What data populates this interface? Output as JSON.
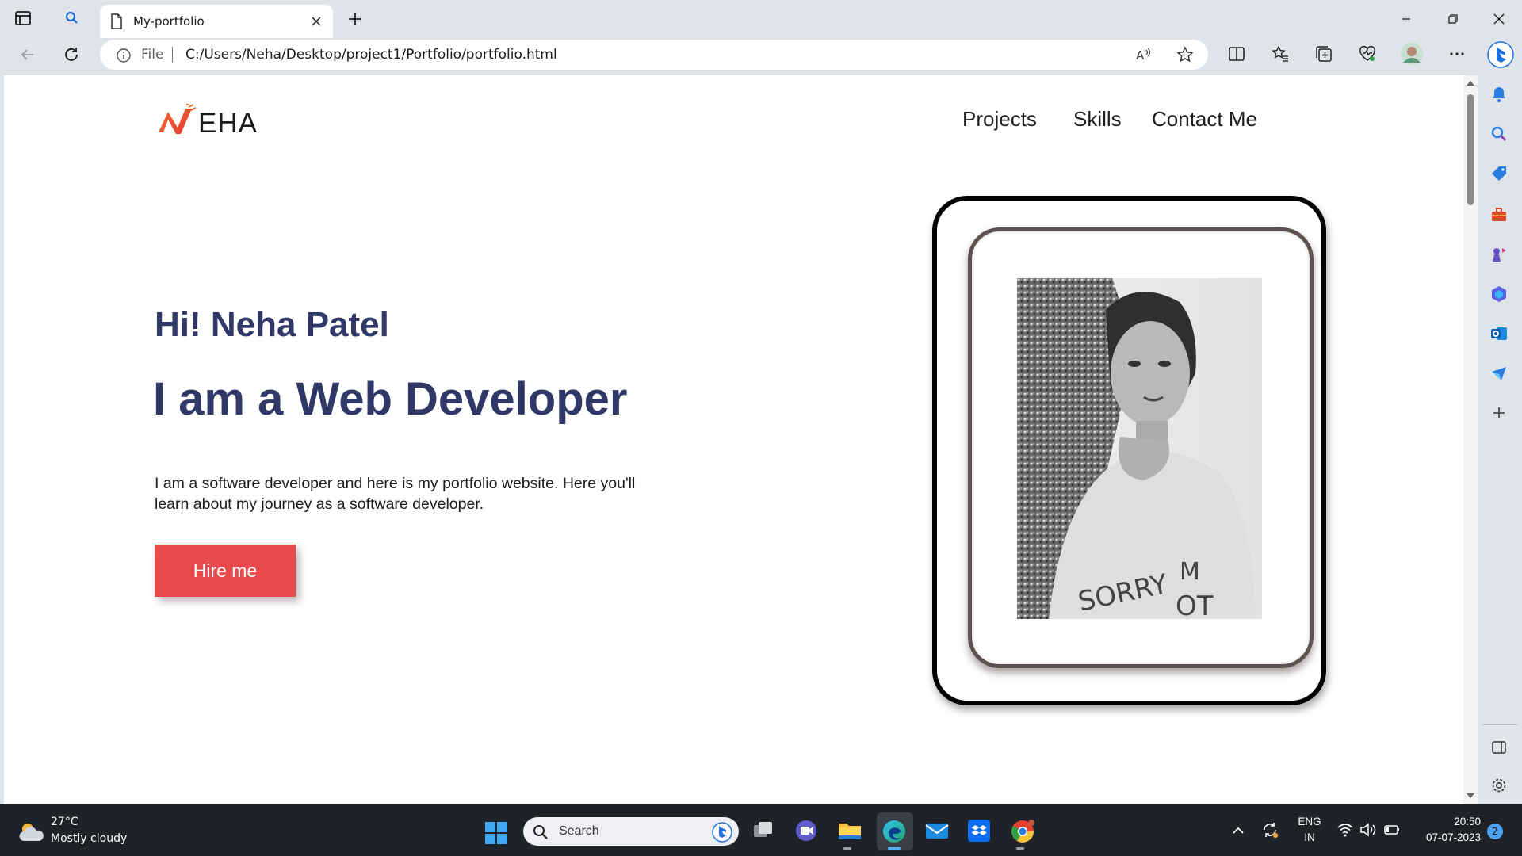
{
  "browser": {
    "tab_title": "My-portfolio",
    "address_prefix": "File",
    "url": "C:/Users/Neha/Desktop/project1/Portfolio/portfolio.html"
  },
  "page": {
    "logo_text": "EHA",
    "nav": [
      "Projects",
      "Skills",
      "Contact Me"
    ],
    "greeting": "Hi! Neha Patel",
    "headline": "I am a Web Developer",
    "intro": "I am a software developer and here is my portfolio website. Here you'll learn about my journey as a software developer.",
    "cta_label": "Hire me",
    "photo_alt": "Portrait photo",
    "accent_color": "#e84a4d",
    "heading_color": "#2f3866"
  },
  "taskbar": {
    "weather_temp": "27°C",
    "weather_desc": "Mostly cloudy",
    "search_placeholder": "Search",
    "lang_top": "ENG",
    "lang_bottom": "IN",
    "time": "20:50",
    "date": "07-07-2023",
    "notification_count": "2"
  }
}
